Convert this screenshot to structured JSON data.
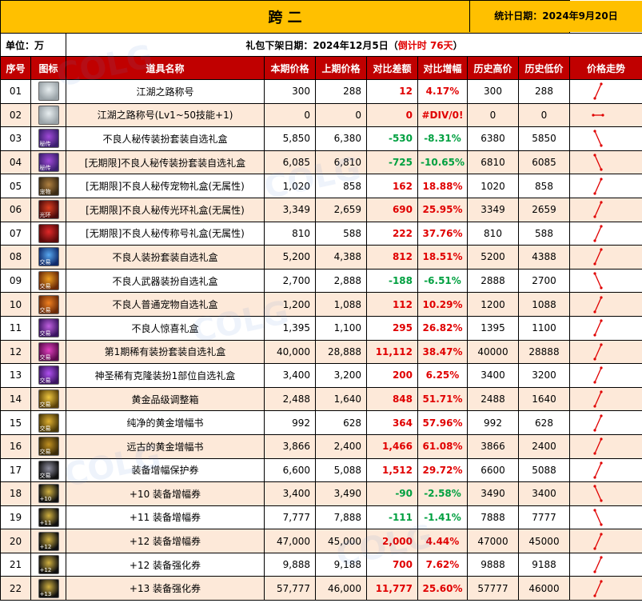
{
  "header": {
    "title": "跨 二",
    "stat_date": "统计日期：2024年9月20日",
    "unit": "单位：万",
    "release_prefix": "礼包下架日期：2024年12月5日（",
    "release_countdown": "倒计时 76天",
    "release_suffix": "）"
  },
  "columns": [
    "序号",
    "图标",
    "道具名称",
    "本期价格",
    "上期价格",
    "对比差额",
    "对比增幅",
    "历史高价",
    "历史低价",
    "价格走势"
  ],
  "colors": {
    "title_bg": "#ffc000",
    "header_bg": "#c00000",
    "row_alt_bg": "#fde9d9",
    "positive": "#e00000",
    "negative": "#00a040"
  },
  "rows": [
    {
      "no": "01",
      "name": "江湖之路称号",
      "cur": "300",
      "prev": "288",
      "diff": "12",
      "pct": "4.17%",
      "high": "300",
      "low": "288",
      "sign": "pos",
      "trend": "up",
      "icon": {
        "name": "title-icon",
        "c1": "#9aa3a8",
        "c2": "#e8eef0",
        "tag": ""
      }
    },
    {
      "no": "02",
      "name": "江湖之路称号(Lv1~50技能+1)",
      "cur": "0",
      "prev": "0",
      "diff": "0",
      "pct": "#DIV/0!",
      "high": "0",
      "low": "0",
      "sign": "zero",
      "trend": "flat",
      "icon": {
        "name": "title-icon",
        "c1": "#9aa3a8",
        "c2": "#e8eef0",
        "tag": ""
      }
    },
    {
      "no": "03",
      "name": "不良人秘传装扮套装自选礼盒",
      "cur": "5,850",
      "prev": "6,380",
      "diff": "-530",
      "pct": "-8.31%",
      "high": "6380",
      "low": "5850",
      "sign": "neg",
      "trend": "down",
      "icon": {
        "name": "avatar-box-icon",
        "c1": "#3b1f6e",
        "c2": "#a04ad8",
        "tag": "秘传"
      }
    },
    {
      "no": "04",
      "name": "[无期限]不良人秘传装扮套装自选礼盒",
      "cur": "6,085",
      "prev": "6,810",
      "diff": "-725",
      "pct": "-10.65%",
      "high": "6810",
      "low": "6085",
      "sign": "neg",
      "trend": "down",
      "icon": {
        "name": "avatar-box-icon",
        "c1": "#3b1f6e",
        "c2": "#a04ad8",
        "tag": "秘传"
      }
    },
    {
      "no": "05",
      "name": "[无期限]不良人秘传宠物礼盒(无属性)",
      "cur": "1,020",
      "prev": "858",
      "diff": "162",
      "pct": "18.88%",
      "high": "1020",
      "low": "858",
      "sign": "pos",
      "trend": "up",
      "icon": {
        "name": "pet-box-icon",
        "c1": "#3a2a14",
        "c2": "#b08040",
        "tag": "宠物"
      }
    },
    {
      "no": "06",
      "name": "[无期限]不良人秘传光环礼盒(无属性)",
      "cur": "3,349",
      "prev": "2,659",
      "diff": "690",
      "pct": "25.95%",
      "high": "3349",
      "low": "2659",
      "sign": "pos",
      "trend": "up",
      "icon": {
        "name": "aura-box-icon",
        "c1": "#4a0a0a",
        "c2": "#e04020",
        "tag": "光环"
      }
    },
    {
      "no": "07",
      "name": "[无期限]不良人秘传称号礼盒(无属性)",
      "cur": "810",
      "prev": "588",
      "diff": "222",
      "pct": "37.76%",
      "high": "810",
      "low": "588",
      "sign": "pos",
      "trend": "up",
      "icon": {
        "name": "title-box-icon",
        "c1": "#5a0a0a",
        "c2": "#e02828",
        "tag": ""
      }
    },
    {
      "no": "08",
      "name": "不良人装扮套装自选礼盒",
      "cur": "5,200",
      "prev": "4,388",
      "diff": "812",
      "pct": "18.51%",
      "high": "5200",
      "low": "4388",
      "sign": "pos",
      "trend": "up",
      "icon": {
        "name": "avatar-box-icon",
        "c1": "#102a6a",
        "c2": "#58a8f0",
        "tag": "交易"
      }
    },
    {
      "no": "09",
      "name": "不良人武器装扮自选礼盒",
      "cur": "2,700",
      "prev": "2,888",
      "diff": "-188",
      "pct": "-6.51%",
      "high": "2888",
      "low": "2700",
      "sign": "neg",
      "trend": "down",
      "icon": {
        "name": "weapon-box-icon",
        "c1": "#6a2a08",
        "c2": "#f0a020",
        "tag": "交易"
      }
    },
    {
      "no": "10",
      "name": "不良人普通宠物自选礼盒",
      "cur": "1,200",
      "prev": "1,088",
      "diff": "112",
      "pct": "10.29%",
      "high": "1200",
      "low": "1088",
      "sign": "pos",
      "trend": "up",
      "icon": {
        "name": "pet-box-icon",
        "c1": "#6a2a08",
        "c2": "#f08020",
        "tag": "交易"
      }
    },
    {
      "no": "11",
      "name": "不良人惊喜礼盒",
      "cur": "1,395",
      "prev": "1,100",
      "diff": "295",
      "pct": "26.82%",
      "high": "1395",
      "low": "1100",
      "sign": "pos",
      "trend": "up",
      "icon": {
        "name": "gift-box-icon",
        "c1": "#3a1460",
        "c2": "#c060e0",
        "tag": "交易"
      }
    },
    {
      "no": "12",
      "name": "第1期稀有装扮套装自选礼盒",
      "cur": "40,000",
      "prev": "28,888",
      "diff": "11,112",
      "pct": "38.47%",
      "high": "40000",
      "low": "28888",
      "sign": "pos",
      "trend": "up",
      "icon": {
        "name": "rare-avatar-box-icon",
        "c1": "#5a0a4a",
        "c2": "#e040c0",
        "tag": "交易"
      }
    },
    {
      "no": "13",
      "name": "神圣稀有克隆装扮1部位自选礼盒",
      "cur": "3,400",
      "prev": "3,200",
      "diff": "200",
      "pct": "6.25%",
      "high": "3400",
      "low": "3200",
      "sign": "pos",
      "trend": "up",
      "icon": {
        "name": "clone-avatar-box-icon",
        "c1": "#3a1460",
        "c2": "#b050f0",
        "tag": "交易"
      }
    },
    {
      "no": "14",
      "name": "黄金品级调整箱",
      "cur": "2,488",
      "prev": "1,640",
      "diff": "848",
      "pct": "51.71%",
      "high": "2488",
      "low": "1640",
      "sign": "pos",
      "trend": "up",
      "icon": {
        "name": "grade-box-icon",
        "c1": "#5a4008",
        "c2": "#f0c840",
        "tag": "交易"
      }
    },
    {
      "no": "15",
      "name": "纯净的黄金增幅书",
      "cur": "992",
      "prev": "628",
      "diff": "364",
      "pct": "57.96%",
      "high": "992",
      "low": "628",
      "sign": "pos",
      "trend": "up",
      "icon": {
        "name": "amplify-book-icon",
        "c1": "#4a3808",
        "c2": "#e0b030",
        "tag": "交易"
      }
    },
    {
      "no": "16",
      "name": "远古的黄金增幅书",
      "cur": "3,866",
      "prev": "2,400",
      "diff": "1,466",
      "pct": "61.08%",
      "high": "3866",
      "low": "2400",
      "sign": "pos",
      "trend": "up",
      "icon": {
        "name": "amplify-book-icon",
        "c1": "#3a2a08",
        "c2": "#c09020",
        "tag": "交易"
      }
    },
    {
      "no": "17",
      "name": "装备增幅保护券",
      "cur": "6,600",
      "prev": "5,088",
      "diff": "1,512",
      "pct": "29.72%",
      "high": "6600",
      "low": "5088",
      "sign": "pos",
      "trend": "up",
      "icon": {
        "name": "protect-ticket-icon",
        "c1": "#101010",
        "c2": "#9090a0",
        "tag": "交易"
      }
    },
    {
      "no": "18",
      "name": "+10 装备增幅券",
      "cur": "3,400",
      "prev": "3,490",
      "diff": "-90",
      "pct": "-2.58%",
      "high": "3490",
      "low": "3400",
      "sign": "neg",
      "trend": "down",
      "icon": {
        "name": "amplify-ticket-icon",
        "c1": "#101010",
        "c2": "#d0b040",
        "tag": "+10"
      }
    },
    {
      "no": "19",
      "name": "+11 装备增幅券",
      "cur": "7,777",
      "prev": "7,888",
      "diff": "-111",
      "pct": "-1.41%",
      "high": "7888",
      "low": "7777",
      "sign": "neg",
      "trend": "down",
      "icon": {
        "name": "amplify-ticket-icon",
        "c1": "#101010",
        "c2": "#d0b040",
        "tag": "+11"
      }
    },
    {
      "no": "20",
      "name": "+12 装备增幅券",
      "cur": "47,000",
      "prev": "45,000",
      "diff": "2,000",
      "pct": "4.44%",
      "high": "47000",
      "low": "45000",
      "sign": "pos",
      "trend": "up",
      "icon": {
        "name": "amplify-ticket-icon",
        "c1": "#101010",
        "c2": "#d0b040",
        "tag": "+12"
      }
    },
    {
      "no": "21",
      "name": "+12 装备强化券",
      "cur": "9,888",
      "prev": "9,188",
      "diff": "700",
      "pct": "7.62%",
      "high": "9888",
      "low": "9188",
      "sign": "pos",
      "trend": "up",
      "icon": {
        "name": "reinforce-ticket-icon",
        "c1": "#101010",
        "c2": "#d0b040",
        "tag": "+12"
      }
    },
    {
      "no": "22",
      "name": "+13 装备强化券",
      "cur": "57,777",
      "prev": "46,000",
      "diff": "11,777",
      "pct": "25.60%",
      "high": "57777",
      "low": "46000",
      "sign": "pos",
      "trend": "up",
      "icon": {
        "name": "reinforce-ticket-icon",
        "c1": "#101010",
        "c2": "#d0b040",
        "tag": "+13"
      }
    }
  ]
}
